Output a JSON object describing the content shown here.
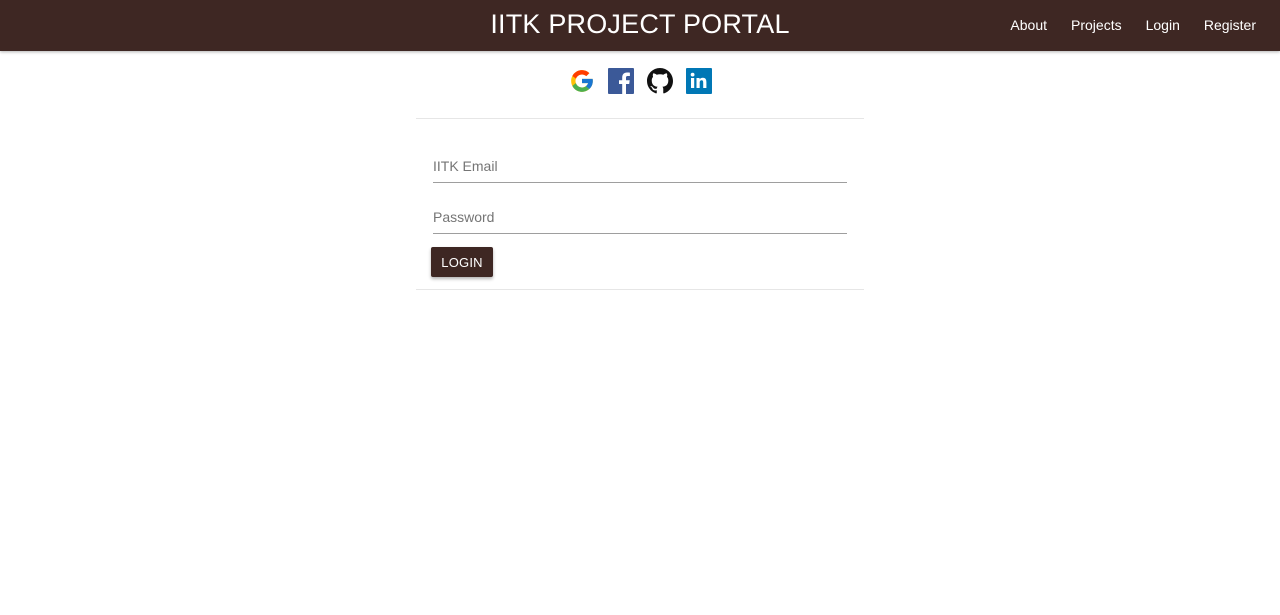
{
  "navbar": {
    "title": "IITK PROJECT PORTAL",
    "links": [
      {
        "label": "About"
      },
      {
        "label": "Projects"
      },
      {
        "label": "Login"
      },
      {
        "label": "Register"
      }
    ]
  },
  "social": [
    {
      "icon": "google-icon"
    },
    {
      "icon": "facebook-icon"
    },
    {
      "icon": "github-icon"
    },
    {
      "icon": "linkedin-icon"
    }
  ],
  "form": {
    "email": {
      "placeholder": "IITK Email",
      "value": ""
    },
    "password": {
      "placeholder": "Password",
      "value": ""
    },
    "submit_label": "LOGIN"
  },
  "colors": {
    "primary": "#3e2723",
    "facebook": "#3b5998",
    "linkedin": "#0077b5"
  }
}
